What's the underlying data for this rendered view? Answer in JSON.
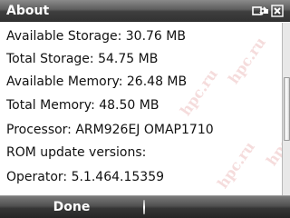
{
  "window": {
    "title": "About"
  },
  "status": {
    "icons": [
      "sync-icon",
      "close-icon"
    ]
  },
  "info": {
    "available_storage": "Available Storage: 30.76 MB",
    "total_storage": "Total Storage: 54.75 MB",
    "available_memory": "Available Memory: 26.48 MB",
    "total_memory": "Total Memory: 48.50 MB",
    "processor": "Processor: ARM926EJ OMAP1710",
    "rom_update": "ROM update versions:",
    "operator": "Operator: 5.1.464.15359"
  },
  "watermark": {
    "text": "hpc.ru"
  },
  "softkeys": {
    "left": "Done"
  },
  "colors": {
    "text": "#111111",
    "bar_dark": "#333333",
    "watermark": "#c83c3c"
  }
}
